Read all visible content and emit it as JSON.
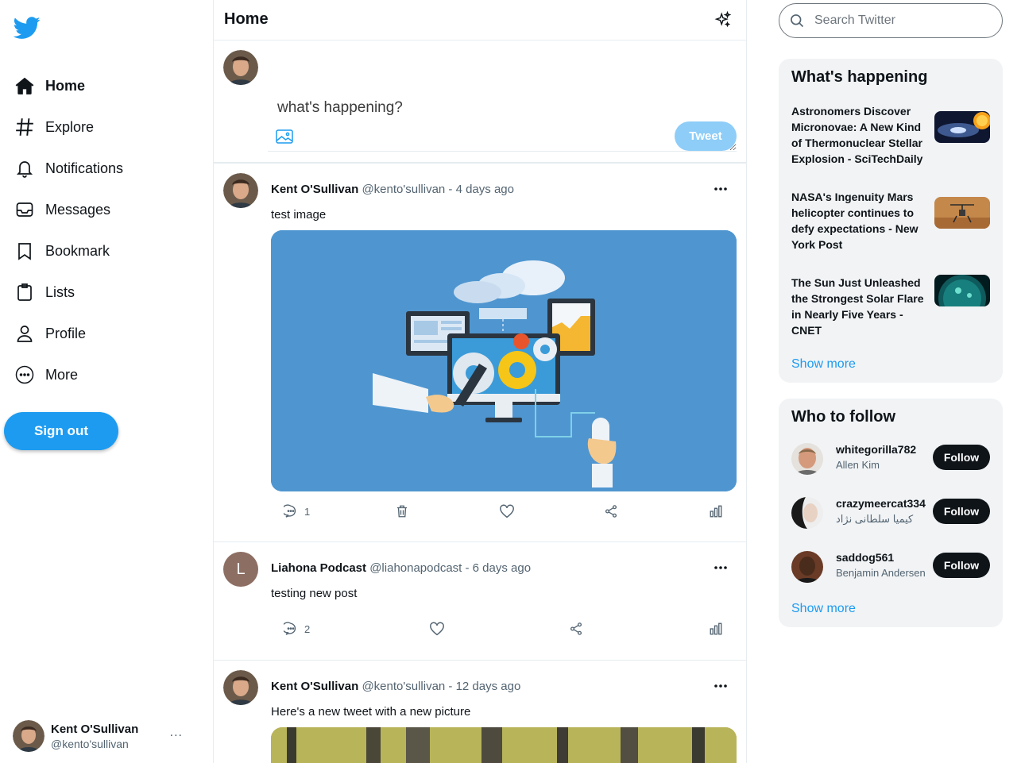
{
  "sidebar": {
    "nav": [
      {
        "label": "Home",
        "icon": "home-icon",
        "active": true
      },
      {
        "label": "Explore",
        "icon": "hashtag-icon"
      },
      {
        "label": "Notifications",
        "icon": "bell-icon"
      },
      {
        "label": "Messages",
        "icon": "inbox-icon"
      },
      {
        "label": "Bookmark",
        "icon": "bookmark-icon"
      },
      {
        "label": "Lists",
        "icon": "clipboard-icon"
      },
      {
        "label": "Profile",
        "icon": "user-icon"
      },
      {
        "label": "More",
        "icon": "more-circle-icon"
      }
    ],
    "signout_label": "Sign out",
    "account": {
      "name": "Kent O'Sullivan",
      "handle": "@kento'sullivan",
      "menu": "..."
    }
  },
  "main": {
    "title": "Home",
    "composer": {
      "placeholder": "what's happening?",
      "tweet_label": "Tweet"
    },
    "tweets": [
      {
        "name": "Kent O'Sullivan",
        "meta": "@kento'sullivan - 4 days ago",
        "text": "test image",
        "replies": "1"
      },
      {
        "name": "Liahona Podcast",
        "meta": "@liahonapodcast - 6 days ago",
        "text": "testing new post",
        "replies": "2",
        "avatar_letter": "L"
      },
      {
        "name": "Kent O'Sullivan",
        "meta": "@kento'sullivan - 12 days ago",
        "text": "Here's a new tweet with a new picture"
      }
    ]
  },
  "right": {
    "search_placeholder": "Search Twitter",
    "happening": {
      "title": "What's happening",
      "items": [
        {
          "text": "Astronomers Discover Micronovae: A New Kind of Thermonuclear Stellar Explosion - SciTechDaily"
        },
        {
          "text": "NASA's Ingenuity Mars helicopter continues to defy expectations - New York Post"
        },
        {
          "text": "The Sun Just Unleashed the Strongest Solar Flare in Nearly Five Years - CNET"
        }
      ],
      "show_more": "Show more"
    },
    "who_to_follow": {
      "title": "Who to follow",
      "items": [
        {
          "username": "whitegorilla782",
          "name": "Allen Kim"
        },
        {
          "username": "crazymeercat334",
          "name": "کیمیا سلطانی نژاد"
        },
        {
          "username": "saddog561",
          "name": "Benjamin Andersen"
        }
      ],
      "follow_label": "Follow",
      "show_more": "Show more"
    }
  },
  "colors": {
    "accent": "#1d9bf0",
    "tweet_disabled": "#8ecdf8",
    "panel_bg": "#f1f3f5"
  }
}
